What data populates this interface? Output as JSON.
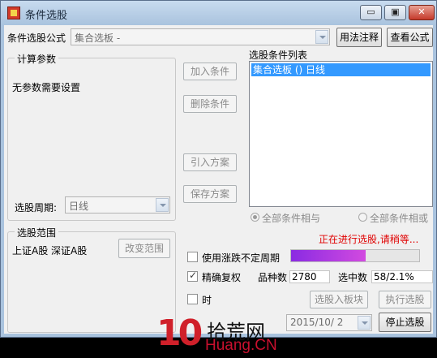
{
  "window": {
    "title": "条件选股",
    "min_glyph": "▭",
    "max_glyph": "▣",
    "close_glyph": "✕"
  },
  "formula": {
    "label": "条件选股公式",
    "value": "集合选板 -",
    "usage_button": "用法注释",
    "view_button": "查看公式"
  },
  "params": {
    "group_title": "计算参数",
    "message": "无参数需要设置",
    "period_label": "选股周期:",
    "period_value": "日线"
  },
  "actions": {
    "add_condition": "加入条件",
    "delete_condition": "删除条件",
    "import_scheme": "引入方案",
    "save_scheme": "保存方案"
  },
  "conditions": {
    "title": "选股条件列表",
    "items": [
      "集合选板 () 日线"
    ],
    "radio_all_and": "全部条件相与",
    "radio_all_or": "全部条件相或"
  },
  "scope": {
    "group_title": "选股范围",
    "value": "上证A股 深证A股",
    "change_button": "改变范围"
  },
  "status": {
    "message": "正在进行选股,请稍等...",
    "color": "#e00000",
    "progress_fraction": 0.58
  },
  "options": {
    "use_uncertain_period": "使用涨跌不定周期",
    "precise_rights": "精确复权",
    "time_condition": "时"
  },
  "stats": {
    "count_label": "品种数",
    "count_value": "2780",
    "selected_label": "选中数",
    "selected_value": "58/2.1%"
  },
  "footer": {
    "date_value": "2015/10/ 2",
    "to_block_button": "选股入板块",
    "run_button": "执行选股",
    "stop_button": "停止选股"
  },
  "watermark": {
    "number": "10",
    "chinese": "拾荒网",
    "latin": "Huang.CN"
  }
}
